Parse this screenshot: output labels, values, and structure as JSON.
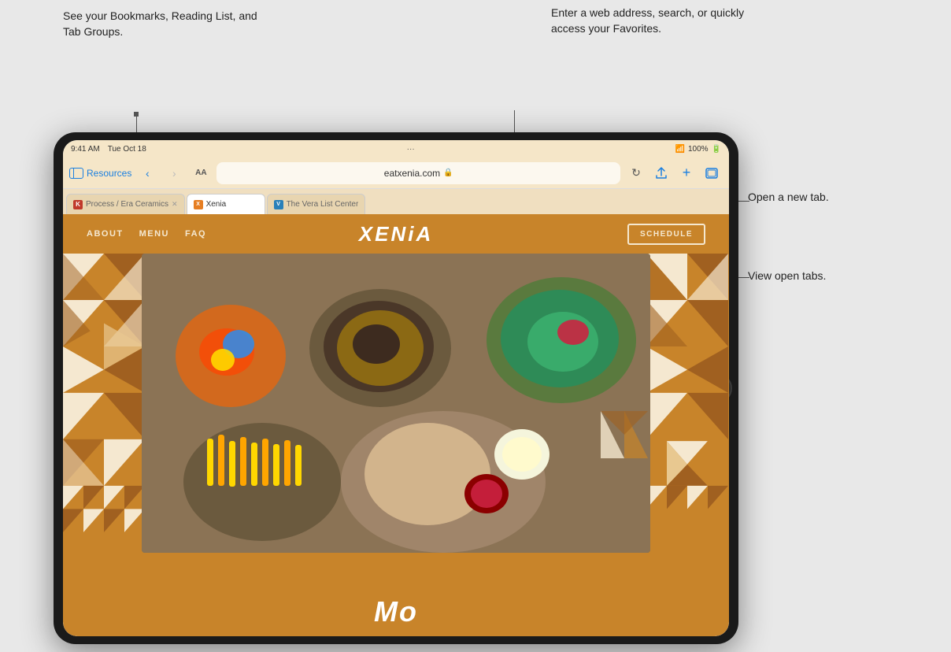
{
  "annotations": {
    "bookmarks_text": "See your\nBookmarks,\nReading List,\nand Tab Groups.",
    "address_text": "Enter a web\naddress, search, or\nquickly access your\nFavorites.",
    "new_tab_text": "Open a new tab.",
    "view_tabs_text": "View open tabs."
  },
  "status_bar": {
    "time": "9:41 AM",
    "date": "Tue Oct 18",
    "wifi": "100%"
  },
  "toolbar": {
    "sidebar_label": "Resources",
    "address": "eatxenia.com",
    "back": "‹",
    "forward": "›",
    "reader_view": "AA",
    "reload": "↻",
    "share": "↑",
    "new_tab": "+",
    "tab_overview": "⊞",
    "more": "···"
  },
  "tabs": [
    {
      "label": "Process / Era Ceramics",
      "active": false,
      "has_close": true,
      "favicon_color": "#c0392b"
    },
    {
      "label": "Xenia",
      "active": true,
      "has_close": false,
      "favicon_color": "#e67e22"
    },
    {
      "label": "The Vera List Center",
      "active": false,
      "has_close": false,
      "favicon_color": "#2980b9"
    }
  ],
  "site": {
    "nav_links": [
      "ABOUT",
      "MENU",
      "FAQ"
    ],
    "logo": "XENiA",
    "schedule_btn": "SCHEDULE",
    "bottom_text": "Mo"
  }
}
